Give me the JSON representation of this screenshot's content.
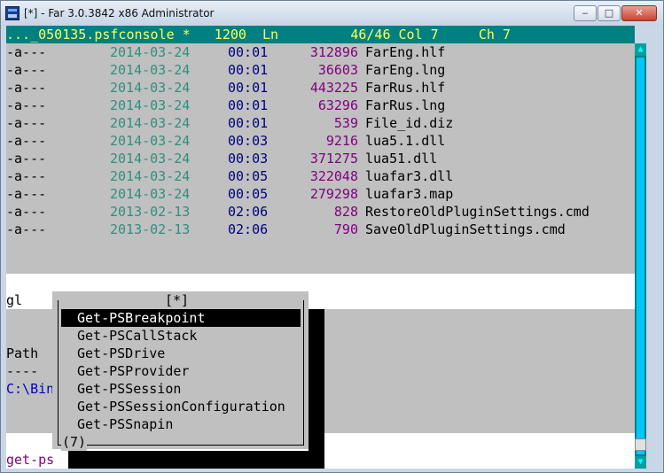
{
  "window": {
    "title": "[*] - Far 3.0.3842 x86 Administrator",
    "min_glyph": "‒",
    "max_glyph": "□",
    "close_glyph": "✕"
  },
  "status_bar": {
    "text": "..._050135.psfconsole *   1200  Ln         46/46 Col 7     Ch 7"
  },
  "files": [
    {
      "attr": "-a---",
      "date": "2014-03-24",
      "time": "00:01",
      "size": "312896",
      "name": "FarEng.hlf"
    },
    {
      "attr": "-a---",
      "date": "2014-03-24",
      "time": "00:01",
      "size": "36603",
      "name": "FarEng.lng"
    },
    {
      "attr": "-a---",
      "date": "2014-03-24",
      "time": "00:01",
      "size": "443225",
      "name": "FarRus.hlf"
    },
    {
      "attr": "-a---",
      "date": "2014-03-24",
      "time": "00:01",
      "size": "63296",
      "name": "FarRus.lng"
    },
    {
      "attr": "-a---",
      "date": "2014-03-24",
      "time": "00:01",
      "size": "539",
      "name": "File_id.diz"
    },
    {
      "attr": "-a---",
      "date": "2014-03-24",
      "time": "00:03",
      "size": "9216",
      "name": "lua5.1.dll"
    },
    {
      "attr": "-a---",
      "date": "2014-03-24",
      "time": "00:03",
      "size": "371275",
      "name": "lua51.dll"
    },
    {
      "attr": "-a---",
      "date": "2014-03-24",
      "time": "00:05",
      "size": "322048",
      "name": "luafar3.dll"
    },
    {
      "attr": "-a---",
      "date": "2014-03-24",
      "time": "00:05",
      "size": "279298",
      "name": "luafar3.map"
    },
    {
      "attr": "-a---",
      "date": "2013-02-13",
      "time": "02:06",
      "size": "828",
      "name": "RestoreOldPluginSettings.cmd"
    },
    {
      "attr": "-a---",
      "date": "2013-02-13",
      "time": "02:06",
      "size": "790",
      "name": "SaveOldPluginSettings.cmd"
    }
  ],
  "console_lines": {
    "gl": "gl",
    "path_header": "Path",
    "path_dashes": "----",
    "path_value": "C:\\Bin",
    "prompt_input": "get-ps"
  },
  "popup": {
    "title": "[*]",
    "count": "(7)",
    "items": [
      "Get-PSBreakpoint",
      "Get-PSCallStack",
      "Get-PSDrive",
      "Get-PSProvider",
      "Get-PSSession",
      "Get-PSSessionConfiguration",
      "Get-PSSnapin"
    ],
    "selected_index": 0
  },
  "scrollbar": {
    "up_glyph": "▲",
    "down_glyph": "▼"
  }
}
